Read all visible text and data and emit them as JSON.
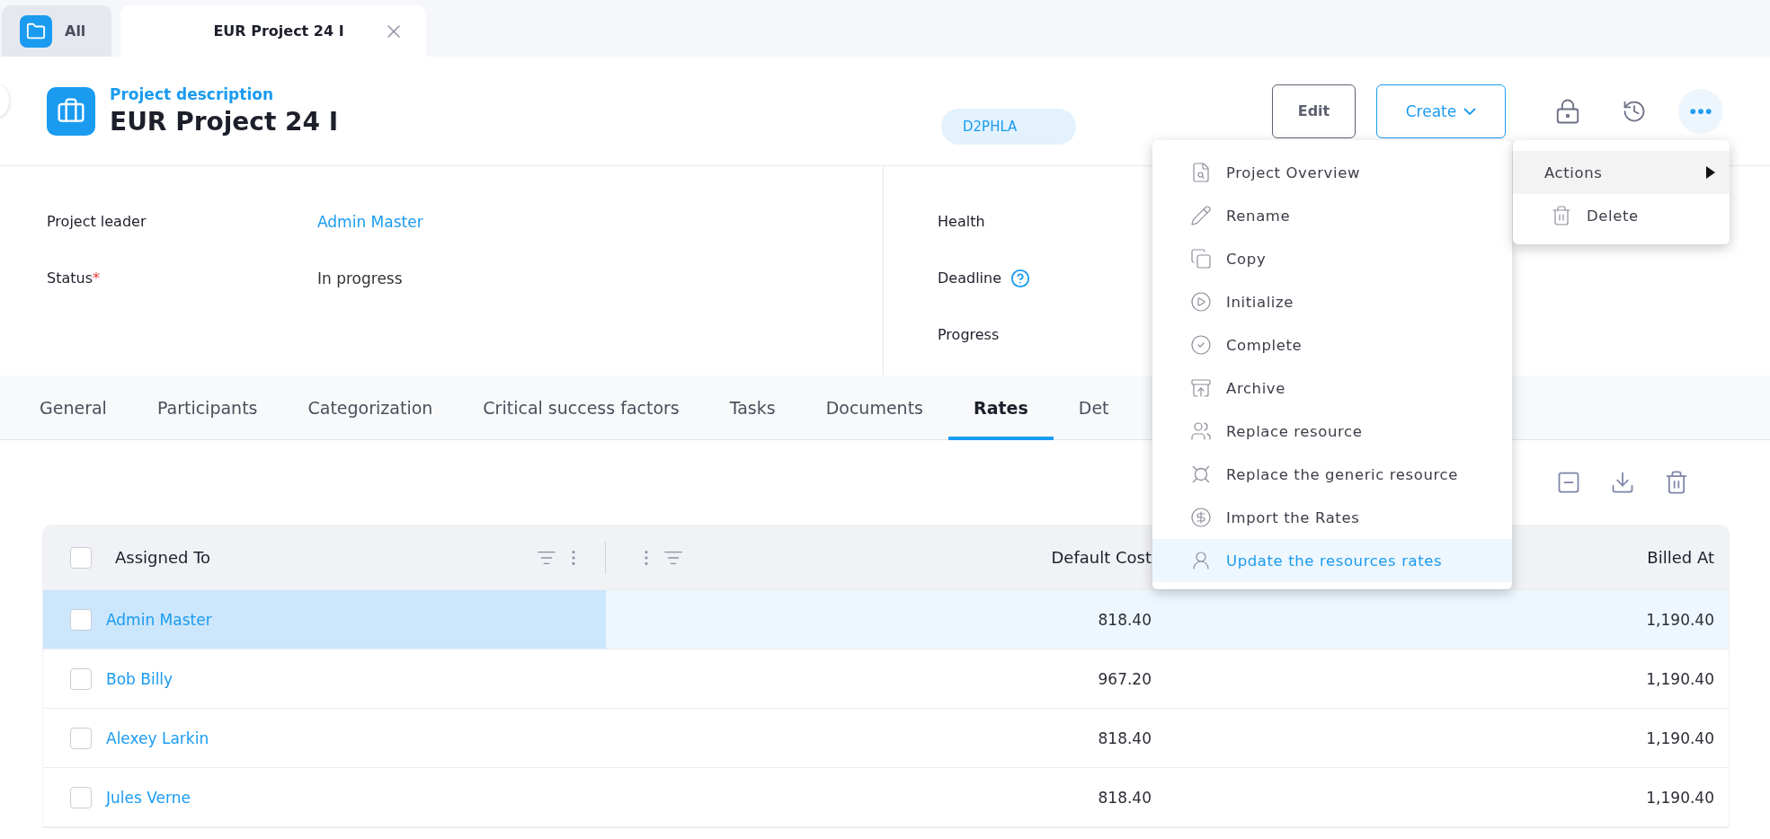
{
  "window_tabs": [
    {
      "label": "All",
      "selected": false,
      "closable": false
    },
    {
      "label": "EUR Project 24 I",
      "selected": true,
      "closable": true
    }
  ],
  "header": {
    "subtitle": "Project description",
    "title": "EUR Project 24 I",
    "code": "D2PHLA",
    "edit_button": "Edit",
    "create_button": "Create"
  },
  "details_left": [
    {
      "label": "Project leader",
      "value": "Admin Master",
      "kind": "link"
    },
    {
      "label": "Status",
      "required_mark": "*",
      "value": "In progress",
      "kind": "text"
    }
  ],
  "details_right": [
    {
      "label": "Health",
      "help": false
    },
    {
      "label": "Deadline",
      "help": true
    },
    {
      "label": "Progress",
      "help": false
    }
  ],
  "section_tabs": [
    {
      "label": "General",
      "selected": false
    },
    {
      "label": "Participants",
      "selected": false
    },
    {
      "label": "Categorization",
      "selected": false
    },
    {
      "label": "Critical success factors",
      "selected": false
    },
    {
      "label": "Tasks",
      "selected": false
    },
    {
      "label": "Documents",
      "selected": false
    },
    {
      "label": "Rates",
      "selected": true
    },
    {
      "label": "Det",
      "selected": false
    }
  ],
  "table": {
    "select_all_checked": false,
    "columns": [
      "Assigned To",
      "Default Cost",
      "Billed At"
    ],
    "rows": [
      {
        "assigned_to": "Admin Master",
        "default_cost": "818.40",
        "billed_at": "1,190.40",
        "selected": true,
        "checked": false
      },
      {
        "assigned_to": "Bob Billy",
        "default_cost": "967.20",
        "billed_at": "1,190.40",
        "selected": false,
        "checked": false
      },
      {
        "assigned_to": "Alexey Larkin",
        "default_cost": "818.40",
        "billed_at": "1,190.40",
        "selected": false,
        "checked": false
      },
      {
        "assigned_to": "Jules Verne",
        "default_cost": "818.40",
        "billed_at": "1,190.40",
        "selected": false,
        "checked": false
      }
    ]
  },
  "more_menu": [
    {
      "label": "Actions",
      "kind": "submenu",
      "selected": true
    },
    {
      "label": "Delete",
      "kind": "action",
      "selected": false
    }
  ],
  "actions_submenu": [
    {
      "label": "Project Overview",
      "selected": false
    },
    {
      "label": "Rename",
      "selected": false
    },
    {
      "label": "Copy",
      "selected": false
    },
    {
      "label": "Initialize",
      "selected": false
    },
    {
      "label": "Complete",
      "selected": false
    },
    {
      "label": "Archive",
      "selected": false
    },
    {
      "label": "Replace resource",
      "selected": false
    },
    {
      "label": "Replace the generic resource",
      "selected": false
    },
    {
      "label": "Import the Rates",
      "selected": false
    },
    {
      "label": "Update the resources rates",
      "selected": true
    }
  ]
}
